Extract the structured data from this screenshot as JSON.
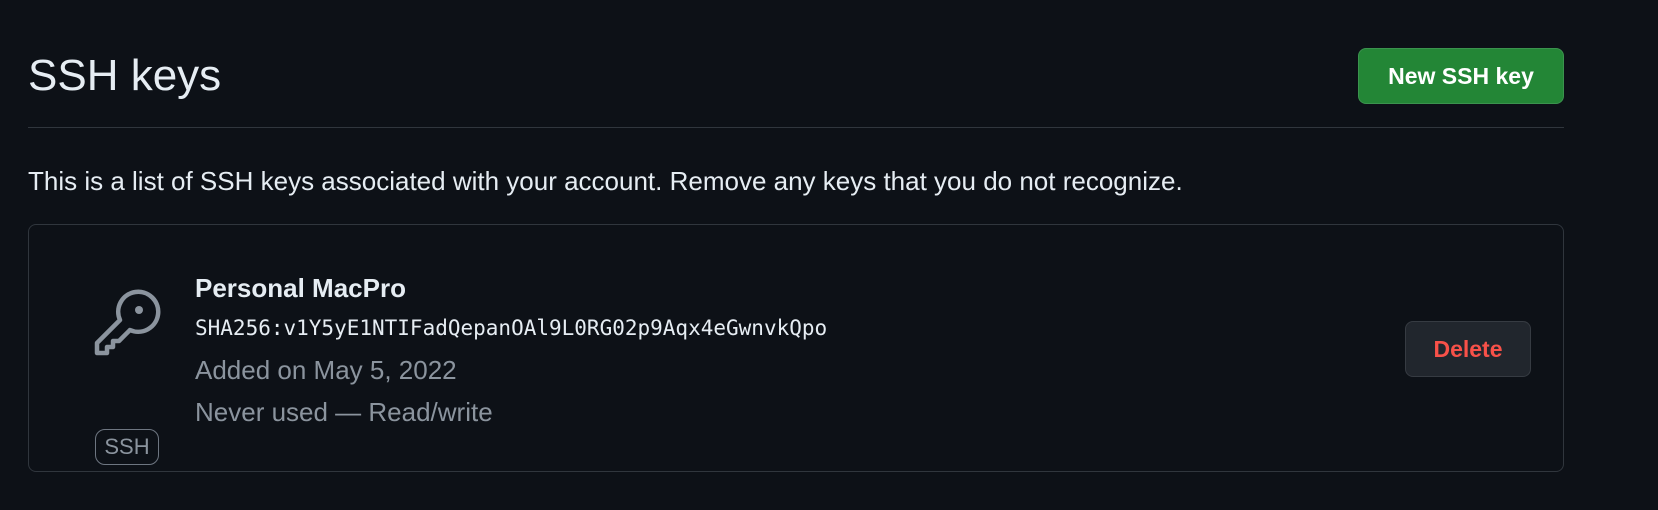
{
  "header": {
    "title": "SSH keys",
    "new_key_label": "New SSH key"
  },
  "description": "This is a list of SSH keys associated with your account. Remove any keys that you do not recognize.",
  "key": {
    "icon": "key-icon",
    "type_label": "SSH",
    "title": "Personal MacPro",
    "fingerprint": "SHA256:v1Y5yE1NTIFadQepanOAl9L0RG02p9Aqx4eGwnvkQpo",
    "added": "Added on May 5, 2022",
    "usage": "Never used — Read/write",
    "delete_label": "Delete"
  },
  "colors": {
    "background": "#0d1117",
    "primary_button": "#238636",
    "danger_text": "#f85149",
    "muted_text": "#8b949e"
  }
}
